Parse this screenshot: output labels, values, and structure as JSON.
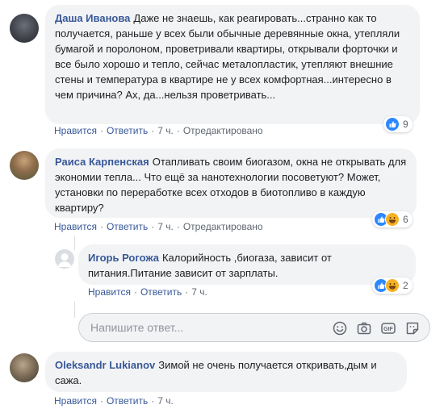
{
  "comments": [
    {
      "author": "Даша Иванова",
      "text": "Даже не знаешь, как реагировать...странно как то получается, раньше у всех были обычные деревянные окна, утепляли бумагой и поролоном, проветривали квартиры, открывали форточки и все было хорошо и тепло, сейчас металопластик, утепляют внешние стены и температура в квартире не у всех комфортная...интересно в чем причина? Ах, да...нельзя проветривать...",
      "like": "Нравится",
      "reply": "Ответить",
      "time": "7 ч.",
      "edited": "Отредактировано",
      "reactions": "9"
    },
    {
      "author": "Раиса Карпенская",
      "text": "Отапливать своим биогазом, окна не открывать для экономии тепла... Что ещё за нанотехнологии посоветуют? Может, установки по переработке всех отходов в биотопливо в каждую квартиру?",
      "like": "Нравится",
      "reply": "Ответить",
      "time": "7 ч.",
      "edited": "Отредактировано",
      "reactions": "6"
    },
    {
      "author": "Игорь Рогожа",
      "text": "Калорийность ,биогаза, зависит от питания.Питание зависит от зарплаты.",
      "like": "Нравится",
      "reply": "Ответить",
      "time": "7 ч.",
      "reactions": "2"
    },
    {
      "author": "Oleksandr Lukianov",
      "text": "Зимой не очень получается откривать,дым и сажа.",
      "like": "Нравится",
      "reply": "Ответить",
      "time": "7 ч."
    }
  ],
  "reply_input": {
    "placeholder": "Напишите ответ..."
  },
  "icons": [
    "like-icon",
    "haha-icon",
    "emoji-icon",
    "camera-icon",
    "gif-icon",
    "sticker-icon"
  ],
  "colors": {
    "author": "#385898",
    "bubble": "#f2f3f5",
    "meta": "#606770",
    "like": "#2d88ff"
  }
}
